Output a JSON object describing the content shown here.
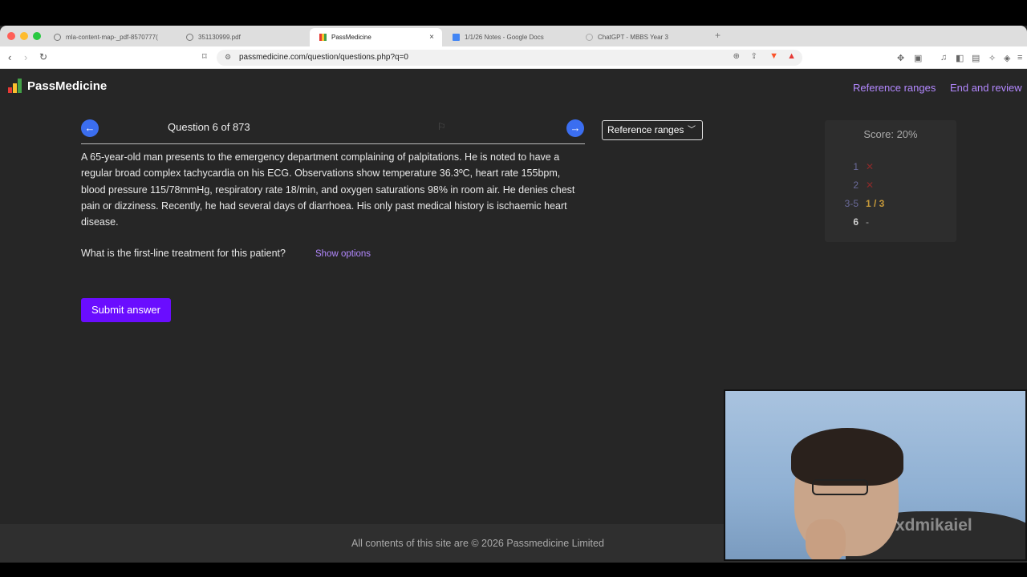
{
  "browser": {
    "tabs": [
      {
        "label": "mla-content-map-_pdf-8570777(",
        "active": false
      },
      {
        "label": "351130999.pdf",
        "active": false
      },
      {
        "label": "PassMedicine",
        "active": true
      },
      {
        "label": "1/1/26 Notes - Google Docs",
        "active": false
      },
      {
        "label": "ChatGPT - MBBS Year 3",
        "active": false
      }
    ],
    "url": "passmedicine.com/question/questions.php?q=0"
  },
  "header": {
    "logo": "PassMedicine",
    "links": [
      "Reference ranges",
      "End and review"
    ]
  },
  "question": {
    "title": "Question 6 of 873",
    "text": "A 65-year-old man presents to the emergency department complaining of palpitations. He is noted to have a regular broad complex tachycardia on his ECG. Observations show temperature 36.3ºC, heart rate 155bpm, blood pressure 115/78mmHg, respiratory rate 18/min, and oxygen saturations 98% in room air. He denies chest pain or dizziness. Recently, he had several days of diarrhoea. His only past medical history is ischaemic heart disease.",
    "prompt": "What is the first-line treatment for this patient?",
    "show_options": "Show options",
    "submit": "Submit answer",
    "reference_dropdown": "Reference ranges"
  },
  "score": {
    "title": "Score: 20%",
    "rows": [
      {
        "num": "1",
        "result": "✕",
        "num_color": "#6a6a9a",
        "result_color": "#8a2a2a"
      },
      {
        "num": "2",
        "result": "✕",
        "num_color": "#6a6a9a",
        "result_color": "#8a2a2a"
      },
      {
        "num": "3-5",
        "result": "1 / 3",
        "num_color": "#6a6a9a",
        "result_color": "#c79a3a"
      },
      {
        "num": "6",
        "result": "-",
        "num_color": "#cfcfcf",
        "result_color": "#aaaaaa"
      }
    ]
  },
  "footer": {
    "text": "All contents of this site are © 2026 Passmedicine Limited"
  },
  "overlay": {
    "watermark": "xdmikaiel"
  },
  "colors": {
    "accent": "#b388ff",
    "submit": "#6a0dff",
    "nav_circle": "#3b6ef0"
  }
}
